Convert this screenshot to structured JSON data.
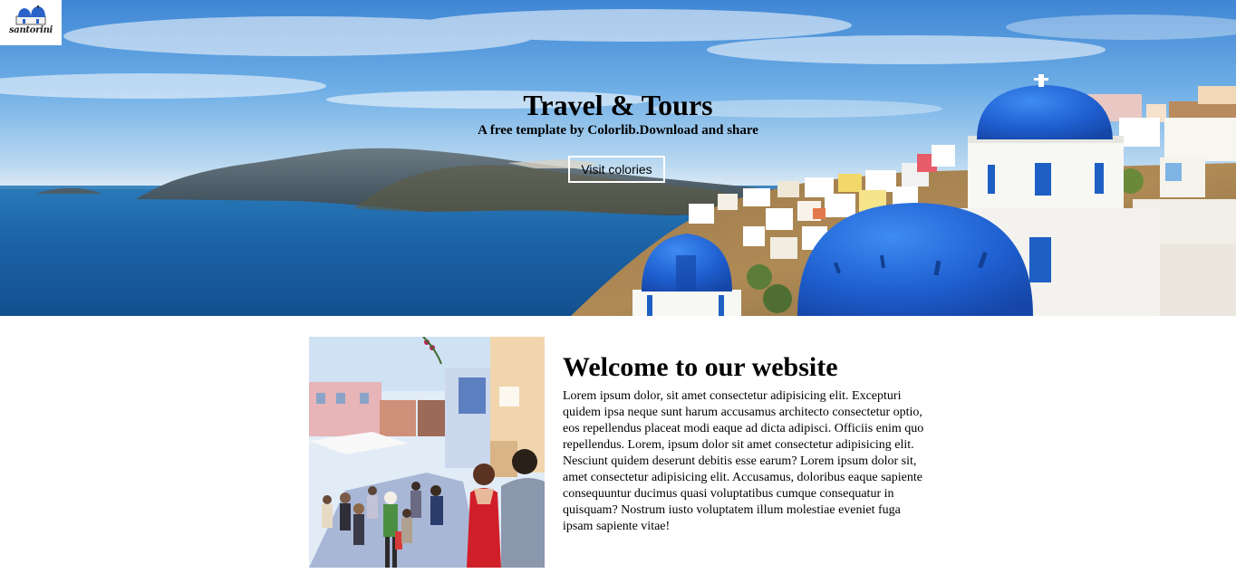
{
  "logo": {
    "text": "santorini"
  },
  "hero": {
    "title": "Travel & Tours",
    "subtitle": "A free template by Colorlib.Download and share",
    "button_label": "Visit colories"
  },
  "welcome": {
    "heading": "Welcome to our website",
    "body": "Lorem ipsum dolor, sit amet consectetur adipisicing elit. Excepturi quidem ipsa neque sunt harum accusamus architecto consectetur optio, eos repellendus placeat modi eaque ad dicta adipisci. Officiis enim quo repellendus. Lorem, ipsum dolor sit amet consectetur adipisicing elit. Nesciunt quidem deserunt debitis esse earum? Lorem ipsum dolor sit, amet consectetur adipisicing elit. Accusamus, doloribus eaque sapiente consequuntur ducimus quasi voluptatibus cumque consequatur in quisquam? Nostrum iusto voluptatem illum molestiae eveniet fuga ipsam sapiente vitae!"
  },
  "colors": {
    "sea": "#1c64a8",
    "dome_blue": "#1f5fd0",
    "page_background": "#ffffff"
  }
}
